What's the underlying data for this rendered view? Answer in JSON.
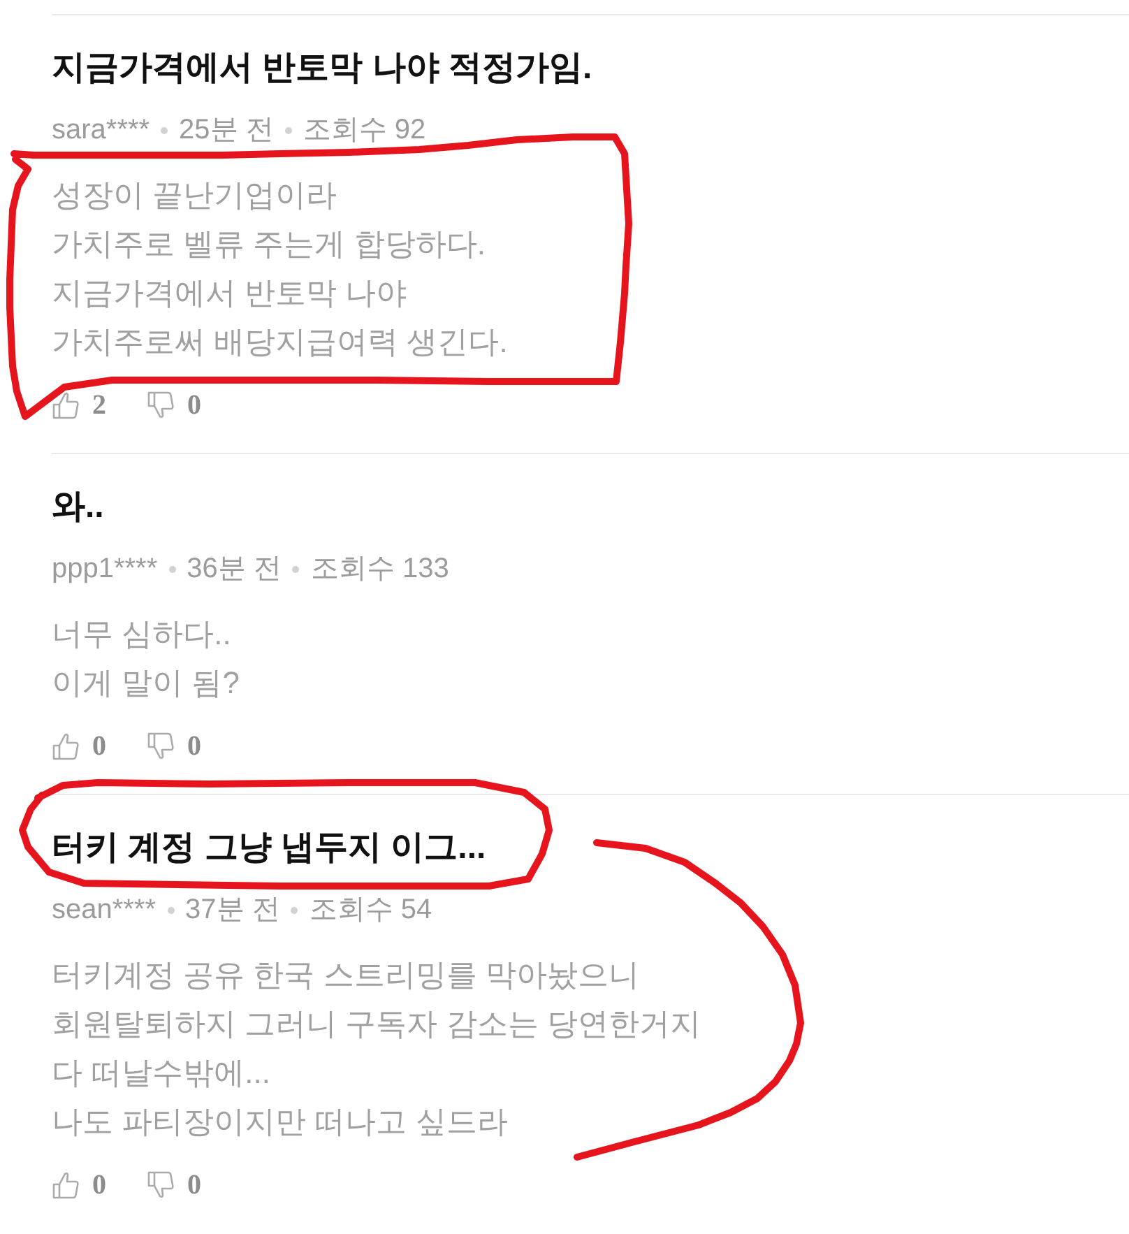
{
  "posts": [
    {
      "title": "지금가격에서 반토막 나야 적정가임.",
      "author": "sara****",
      "time": "25분 전",
      "views": "조회수 92",
      "body": "성장이 끝난기업이라\n가치주로 벨류 주는게 합당하다.\n지금가격에서 반토막 나야\n가치주로써 배당지급여력 생긴다.",
      "likes": "2",
      "dislikes": "0",
      "body_annotation": {
        "kind": "box"
      }
    },
    {
      "title": "와..",
      "author": "ppp1****",
      "time": "36분 전",
      "views": "조회수 133",
      "body": "너무 심하다..\n이게 말이 됨?",
      "likes": "0",
      "dislikes": "0"
    },
    {
      "title": "터키 계정 그냥 냅두지 이그...",
      "author": "sean****",
      "time": "37분 전",
      "views": "조회수 54",
      "body": "터키계정 공유 한국 스트리밍를 막아놨으니\n회원탈퇴하지 그러니 구독자 감소는 당연한거지\n다 떠날수밖에...\n나도 파티장이지만 떠나고 싶드라",
      "likes": "0",
      "dislikes": "0",
      "title_annotation": {
        "kind": "oval"
      },
      "body_annotation": {
        "kind": "arc"
      }
    }
  ]
}
